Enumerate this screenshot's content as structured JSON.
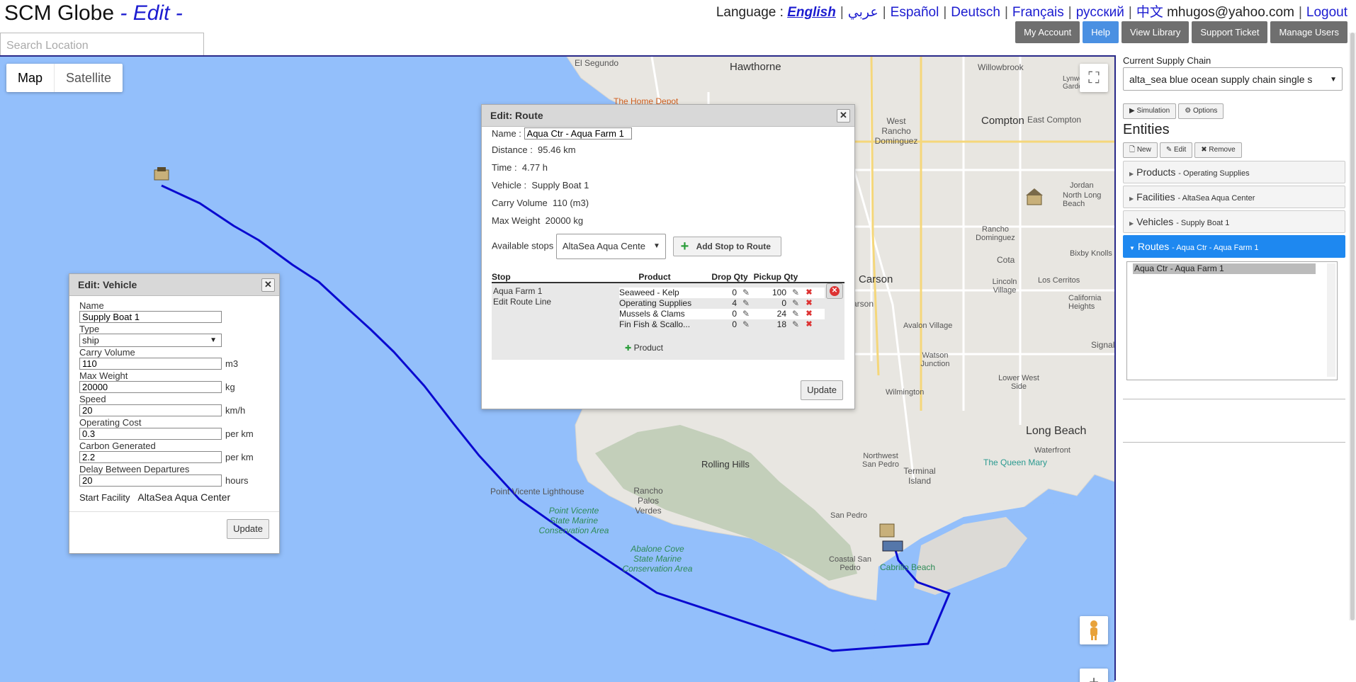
{
  "app": {
    "title": "SCM Globe",
    "mode": " - Edit -"
  },
  "language_bar": {
    "label": "Language :",
    "languages": [
      "English",
      "عربي",
      "Español",
      "Deutsch",
      "Français",
      "русский",
      "中文"
    ],
    "user_email": "mhugos@yahoo.com",
    "logout": "Logout"
  },
  "top_buttons": [
    "My Account",
    "Help",
    "View Library",
    "Support Ticket",
    "Manage Users"
  ],
  "search": {
    "placeholder": "Search Location"
  },
  "map": {
    "type_tabs": [
      "Map",
      "Satellite"
    ],
    "labels": [
      "El Segundo",
      "Hawthorne",
      "The Home Depot",
      "Willowbrook",
      "West Rancho Dominguez",
      "Compton",
      "East Compton",
      "Lynwood Gardens",
      "Rancho Dominguez",
      "Jordan",
      "North Long Beach",
      "Carson",
      "Lincoln Village",
      "Los Cerritos",
      "California Heights",
      "Bixby Knolls",
      "Cota",
      "Avalon Village",
      "Watson Junction",
      "Wilmington",
      "Lower West Side",
      "Signal",
      "Long Beach",
      "The Queen Mary",
      "Waterfront",
      "Northwest San Pedro",
      "Terminal Island",
      "San Pedro",
      "Coastal San Pedro",
      "Cabrillo Beach",
      "Rolling Hills",
      "Rancho Palos Verdes",
      "Point Vicente Lighthouse",
      "Point Vicente State Marine Conservation Area",
      "Abalone Cove State Marine Conservation Area",
      "arson"
    ]
  },
  "vehicle_dialog": {
    "title": "Edit: Vehicle",
    "fields": {
      "name_label": "Name",
      "name": "Supply Boat 1",
      "type_label": "Type",
      "type": "ship",
      "carry_label": "Carry Volume",
      "carry": "110",
      "carry_unit": "m3",
      "weight_label": "Max Weight",
      "weight": "20000",
      "weight_unit": "kg",
      "speed_label": "Speed",
      "speed": "20",
      "speed_unit": "km/h",
      "cost_label": "Operating Cost",
      "cost": "0.3",
      "cost_unit": "per km",
      "carbon_label": "Carbon Generated",
      "carbon": "2.2",
      "carbon_unit": "per km",
      "delay_label": "Delay Between Departures",
      "delay": "20",
      "delay_unit": "hours",
      "start_label": "Start Facility",
      "start": "AltaSea Aqua Center"
    },
    "update": "Update"
  },
  "route_dialog": {
    "title": "Edit: Route",
    "name_label": "Name :",
    "name": "Aqua Ctr - Aqua Farm 1",
    "distance_label": "Distance :",
    "distance": "95.46 km",
    "time_label": "Time :",
    "time": "4.77 h",
    "vehicle_label": "Vehicle :",
    "vehicle": "Supply Boat 1",
    "carry_label": "Carry Volume",
    "carry": "110 (m3)",
    "weight_label": "Max Weight",
    "weight": "20000 kg",
    "stops_label": "Available stops",
    "stops_selected": "AltaSea Aqua Cente",
    "add_stop": "Add Stop to Route",
    "table_headers": [
      "Stop",
      "Product",
      "Drop Qty",
      "Pickup Qty"
    ],
    "stop_name": "Aqua Farm 1",
    "edit_route_line": "Edit Route Line",
    "products": [
      {
        "name": "Seaweed - Kelp",
        "drop": "0",
        "pickup": "100"
      },
      {
        "name": "Operating Supplies",
        "drop": "4",
        "pickup": "0"
      },
      {
        "name": "Mussels & Clams",
        "drop": "0",
        "pickup": "24"
      },
      {
        "name": "Fin Fish & Scallo...",
        "drop": "0",
        "pickup": "18"
      }
    ],
    "add_product": "Product",
    "update": "Update"
  },
  "right_panel": {
    "current_chain_label": "Current Supply Chain",
    "current_chain": "alta_sea blue ocean supply chain single s",
    "simulation": "Simulation",
    "options": "Options",
    "entities_title": "Entities",
    "entity_buttons": [
      "New",
      "Edit",
      "Remove"
    ],
    "accordion": [
      {
        "label": "Products",
        "sub": "- Operating Supplies"
      },
      {
        "label": "Facilities",
        "sub": "- AltaSea Aqua Center"
      },
      {
        "label": "Vehicles",
        "sub": "- Supply Boat 1"
      },
      {
        "label": "Routes",
        "sub": "- Aqua Ctr - Aqua Farm 1"
      }
    ],
    "routes_list": [
      "Aqua Ctr - Aqua Farm 1"
    ]
  },
  "colors": {
    "route_line": "#0a0ad0",
    "water": "#93bffb",
    "land": "#e9e7e2",
    "accent": "#1e88f0"
  }
}
